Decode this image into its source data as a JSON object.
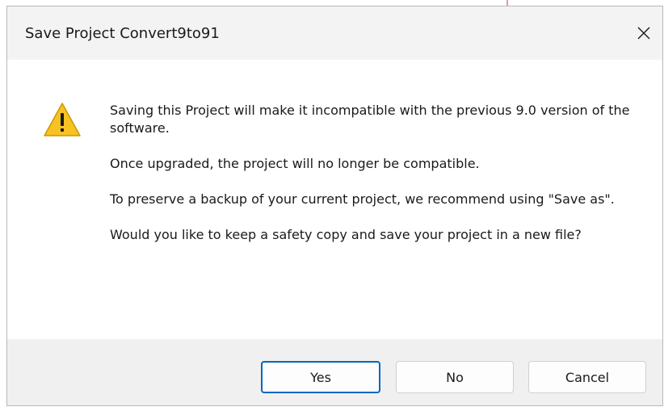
{
  "dialog": {
    "title": "Save Project Convert9to91",
    "close_icon": "close-icon",
    "warning_icon": "warning-triangle-icon",
    "message": {
      "paragraph_1": "Saving this Project will make it incompatible with the previous 9.0 version of the software.",
      "paragraph_2": "Once upgraded, the project will no longer be compatible.",
      "paragraph_3": "To preserve a backup of your current project, we recommend using \"Save as\".",
      "paragraph_4": "Would you like to keep a safety copy and save your project in a new file?"
    },
    "buttons": {
      "yes": "Yes",
      "no": "No",
      "cancel": "Cancel"
    }
  },
  "colors": {
    "accent": "#0067c0",
    "warning_fill": "#f7c223",
    "titlebar_bg": "#f3f3f3",
    "footer_bg": "#f0f0f0"
  }
}
